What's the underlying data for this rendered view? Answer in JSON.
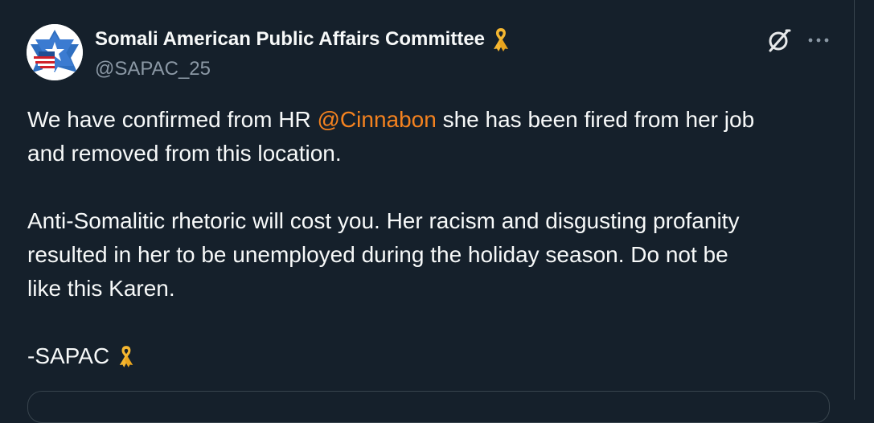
{
  "author": {
    "display_name": "Somali American Public Affairs Committee",
    "handle": "@SAPAC_25",
    "badge_icon": "yellow-ribbon-icon"
  },
  "actions": {
    "grok_icon": "grok-icon",
    "more_icon": "more-icon"
  },
  "body": {
    "line1_pre": "We have confirmed from HR ",
    "line1_mention": "@Cinnabon",
    "line1_post": " she has been fired from her job",
    "line2": "and removed from this location.",
    "line3": "Anti-Somalitic rhetoric will cost you. Her racism and disgusting profanity",
    "line4": "resulted in her to be unemployed during the holiday season. Do not be",
    "line5": "like this Karen.",
    "signature": "-SAPAC"
  },
  "colors": {
    "background": "#15202b",
    "text": "#f7f9f9",
    "secondary_text": "#8b98a5",
    "mention": "#f4821f",
    "ribbon": "#f5b731"
  }
}
